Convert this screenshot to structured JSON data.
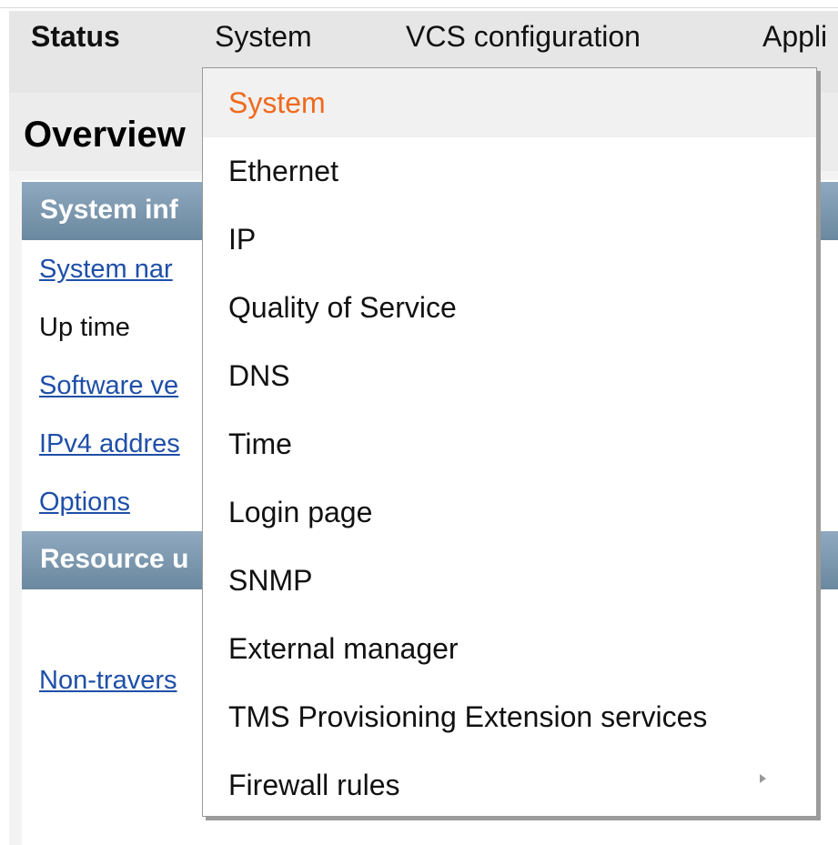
{
  "menubar": {
    "items": [
      "Status",
      "System",
      "VCS configuration",
      "Appli"
    ]
  },
  "page": {
    "title": "Overview"
  },
  "sections": {
    "system_info_header": "System inf",
    "resource_header": "Resource u"
  },
  "rows": {
    "system_name": "System nar",
    "up_time": "Up time",
    "software_version": "Software ve",
    "ipv4_address": "IPv4 addres",
    "options": "Options",
    "non_traversal": "Non-travers"
  },
  "dropdown": {
    "items": [
      "System",
      "Ethernet",
      "IP",
      "Quality of Service",
      "DNS",
      "Time",
      "Login page",
      "SNMP",
      "External manager",
      "TMS Provisioning Extension services",
      "Firewall rules"
    ],
    "active_index": 0,
    "has_submenu_index": 10
  },
  "colors": {
    "active_item": "#f06a1e",
    "link": "#1f4fa8",
    "section_header": "#7a96ad"
  },
  "icons": {
    "submenu": "submenu-arrow-icon"
  }
}
